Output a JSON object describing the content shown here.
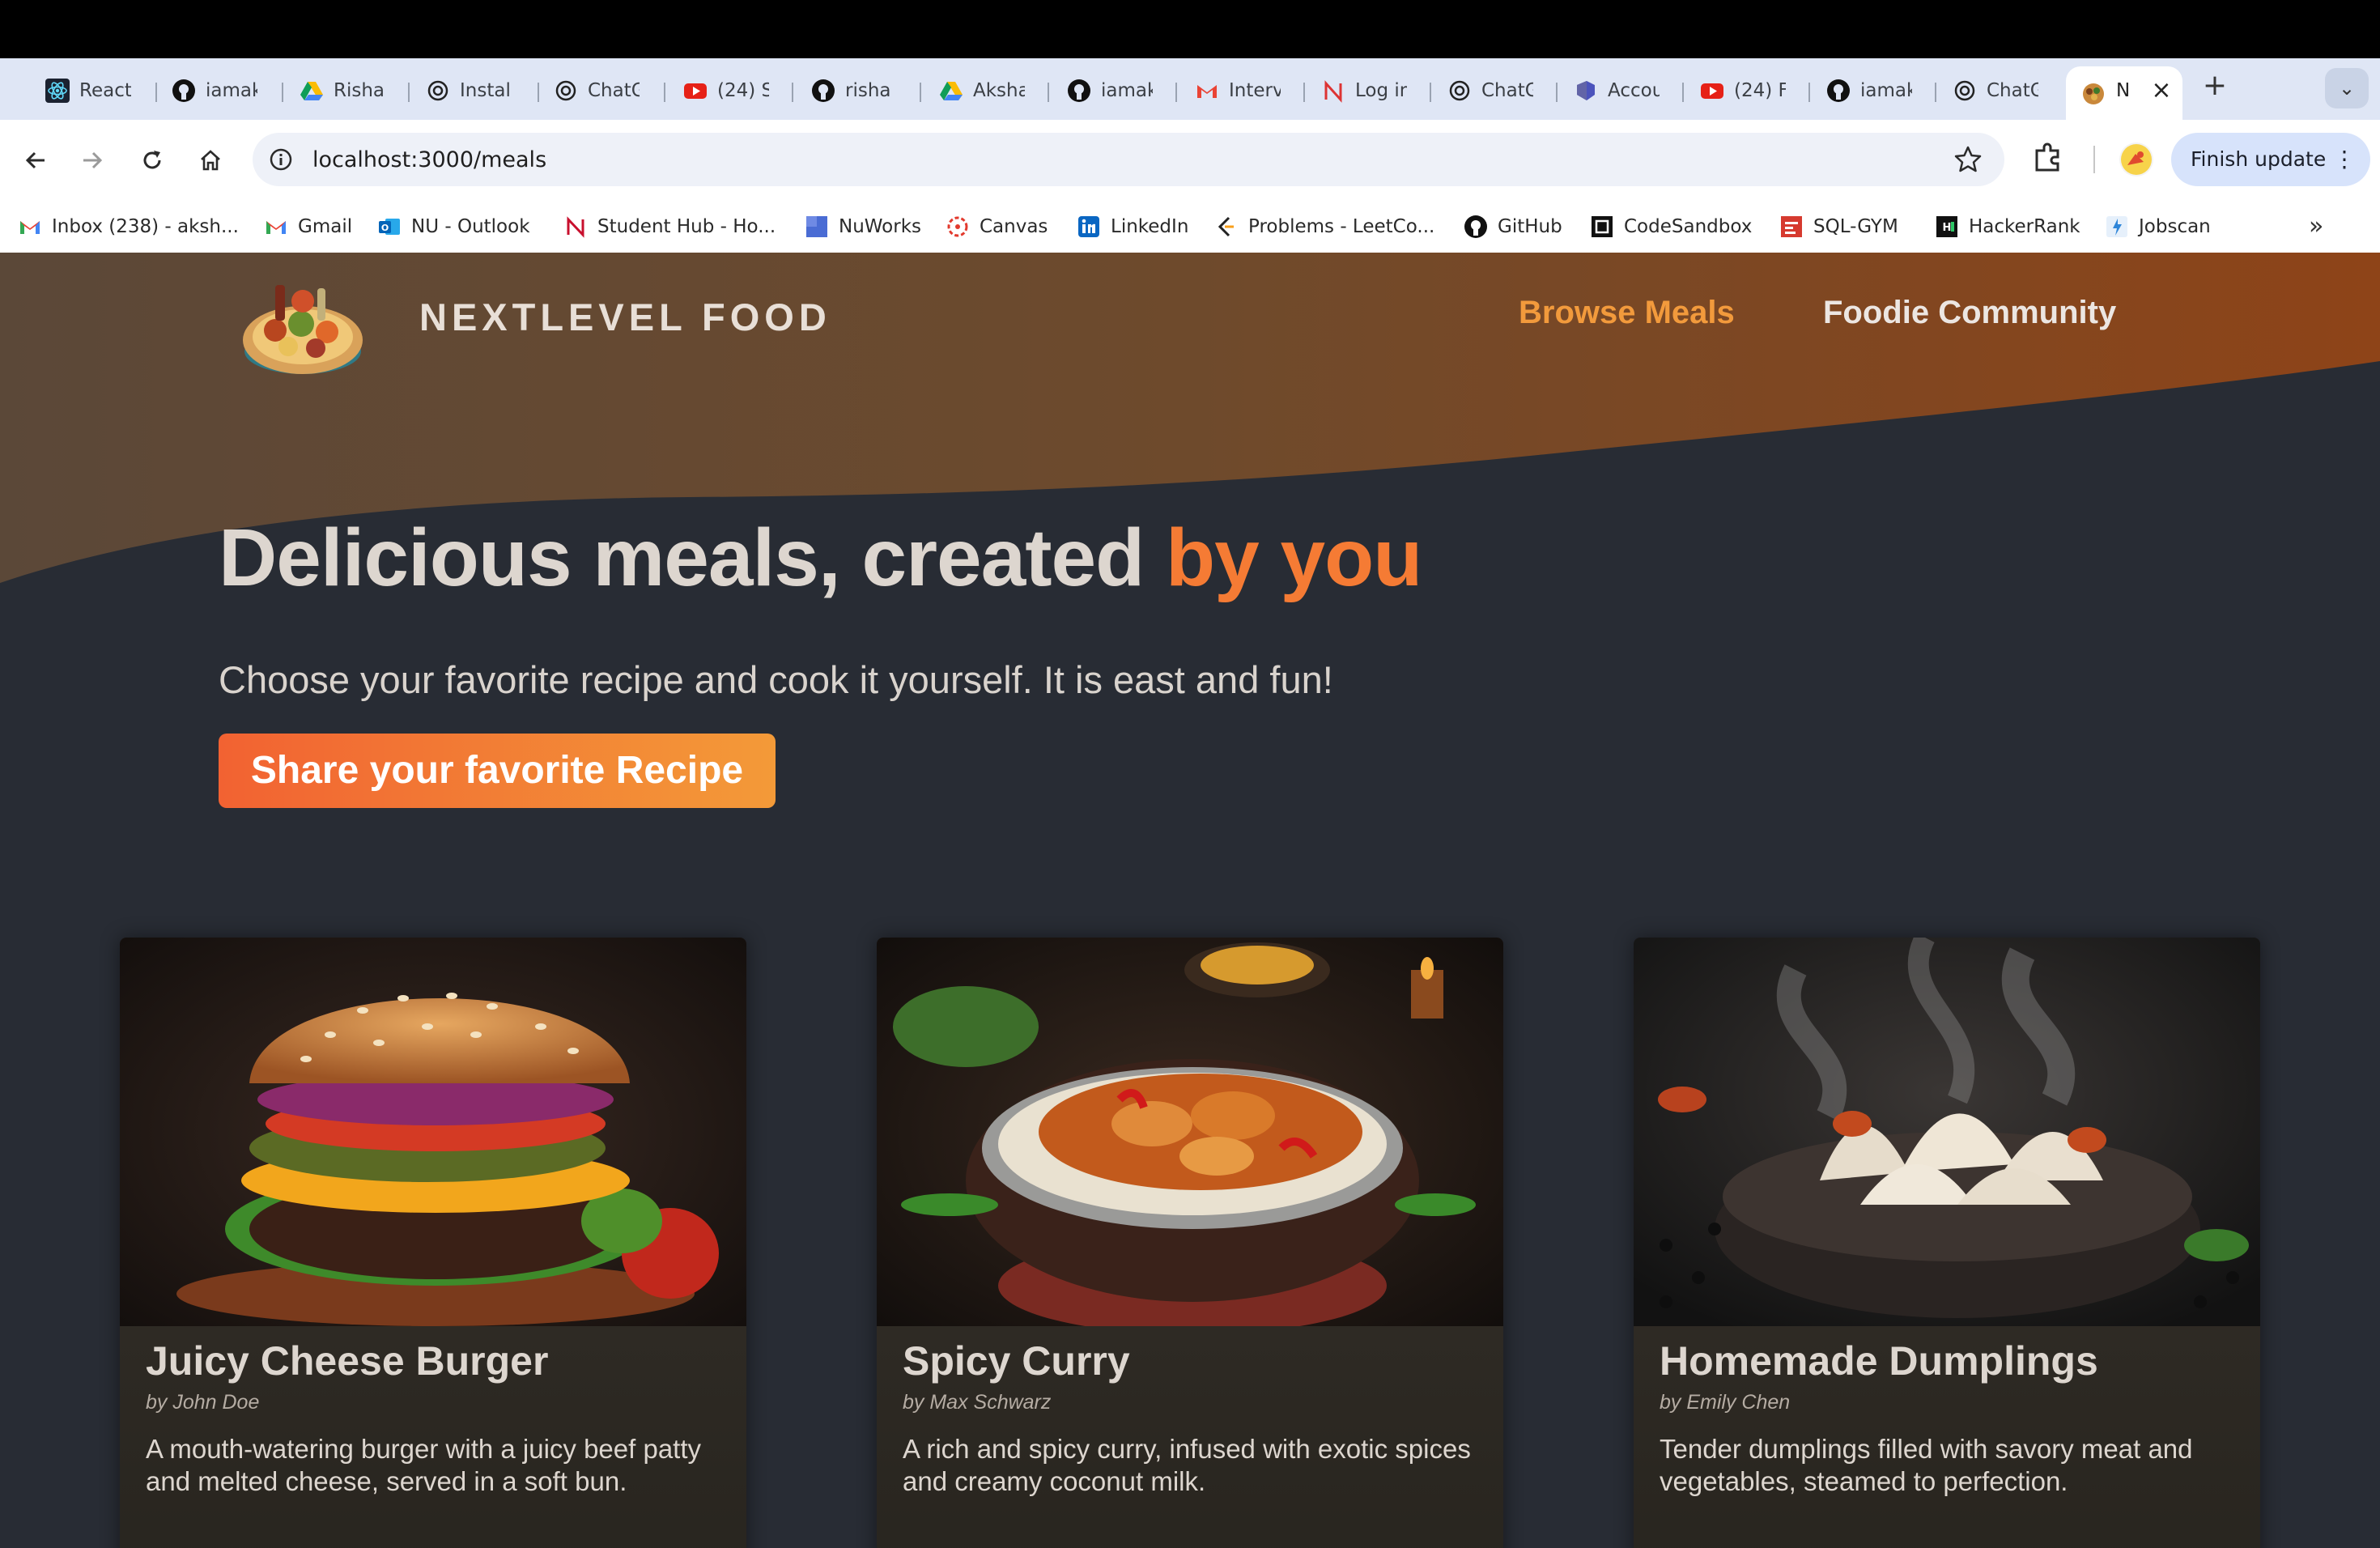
{
  "browser": {
    "tabs": [
      {
        "label": "React",
        "icon": "react-icon"
      },
      {
        "label": "iamak",
        "icon": "github-icon"
      },
      {
        "label": "Risha",
        "icon": "google-drive-icon"
      },
      {
        "label": "Instal",
        "icon": "chatgpt-icon"
      },
      {
        "label": "ChatG",
        "icon": "chatgpt-icon"
      },
      {
        "label": "(24) S",
        "icon": "youtube-icon"
      },
      {
        "label": "risha",
        "icon": "github-icon"
      },
      {
        "label": "Aksha",
        "icon": "google-drive-icon"
      },
      {
        "label": "iamak",
        "icon": "github-icon"
      },
      {
        "label": "Interv",
        "icon": "gmail-icon"
      },
      {
        "label": "Log in",
        "icon": "notion-icon"
      },
      {
        "label": "ChatG",
        "icon": "chatgpt-icon"
      },
      {
        "label": "Accou",
        "icon": "teams-icon"
      },
      {
        "label": "(24) F",
        "icon": "youtube-icon"
      },
      {
        "label": "iamak",
        "icon": "github-icon"
      },
      {
        "label": "ChatG",
        "icon": "chatgpt-icon"
      }
    ],
    "active_tab": {
      "label": "N",
      "icon": "food-logo-icon"
    },
    "url": "localhost:3000/meals",
    "finish_update_label": "Finish update",
    "bookmarks": [
      {
        "label": "Inbox (238) - aksh...",
        "icon": "gmail-icon"
      },
      {
        "label": "Gmail",
        "icon": "gmail-icon"
      },
      {
        "label": "NU - Outlook",
        "icon": "outlook-icon"
      },
      {
        "label": "Student Hub - Ho...",
        "icon": "student-hub-icon"
      },
      {
        "label": "NuWorks",
        "icon": "nuworks-icon"
      },
      {
        "label": "Canvas",
        "icon": "canvas-icon"
      },
      {
        "label": "LinkedIn",
        "icon": "linkedin-icon"
      },
      {
        "label": "Problems - LeetCo...",
        "icon": "leetcode-icon"
      },
      {
        "label": "GitHub",
        "icon": "github-icon"
      },
      {
        "label": "CodeSandbox",
        "icon": "codesandbox-icon"
      },
      {
        "label": "SQL-GYM",
        "icon": "sql-gym-icon"
      },
      {
        "label": "HackerRank",
        "icon": "hackerrank-icon"
      },
      {
        "label": "Jobscan",
        "icon": "jobscan-icon"
      }
    ]
  },
  "header": {
    "brand": "NEXTLEVEL FOOD",
    "nav": [
      {
        "label": "Browse Meals",
        "active": true
      },
      {
        "label": "Foodie Community",
        "active": false
      }
    ]
  },
  "hero": {
    "title_main": "Delicious meals, created ",
    "title_accent": "by you",
    "subtitle": "Choose your favorite recipe and cook it yourself. It is east and fun!",
    "cta_label": "Share your favorite Recipe"
  },
  "meals": [
    {
      "title": "Juicy Cheese Burger",
      "author": "by John Doe",
      "summary": "A mouth-watering burger with a juicy beef patty and melted cheese, served in a soft bun."
    },
    {
      "title": "Spicy Curry",
      "author": "by Max Schwarz",
      "summary": "A rich and spicy curry, infused with exotic spices and creamy coconut milk."
    },
    {
      "title": "Homemade Dumplings",
      "author": "by Emily Chen",
      "summary": "Tender dumplings filled with savory meat and vegetables, steamed to perfection."
    }
  ],
  "colors": {
    "accent": "#f57b34",
    "nav_active": "#f29a3c",
    "page_bg": "#282c34",
    "header_wave": "#6b4a32"
  }
}
